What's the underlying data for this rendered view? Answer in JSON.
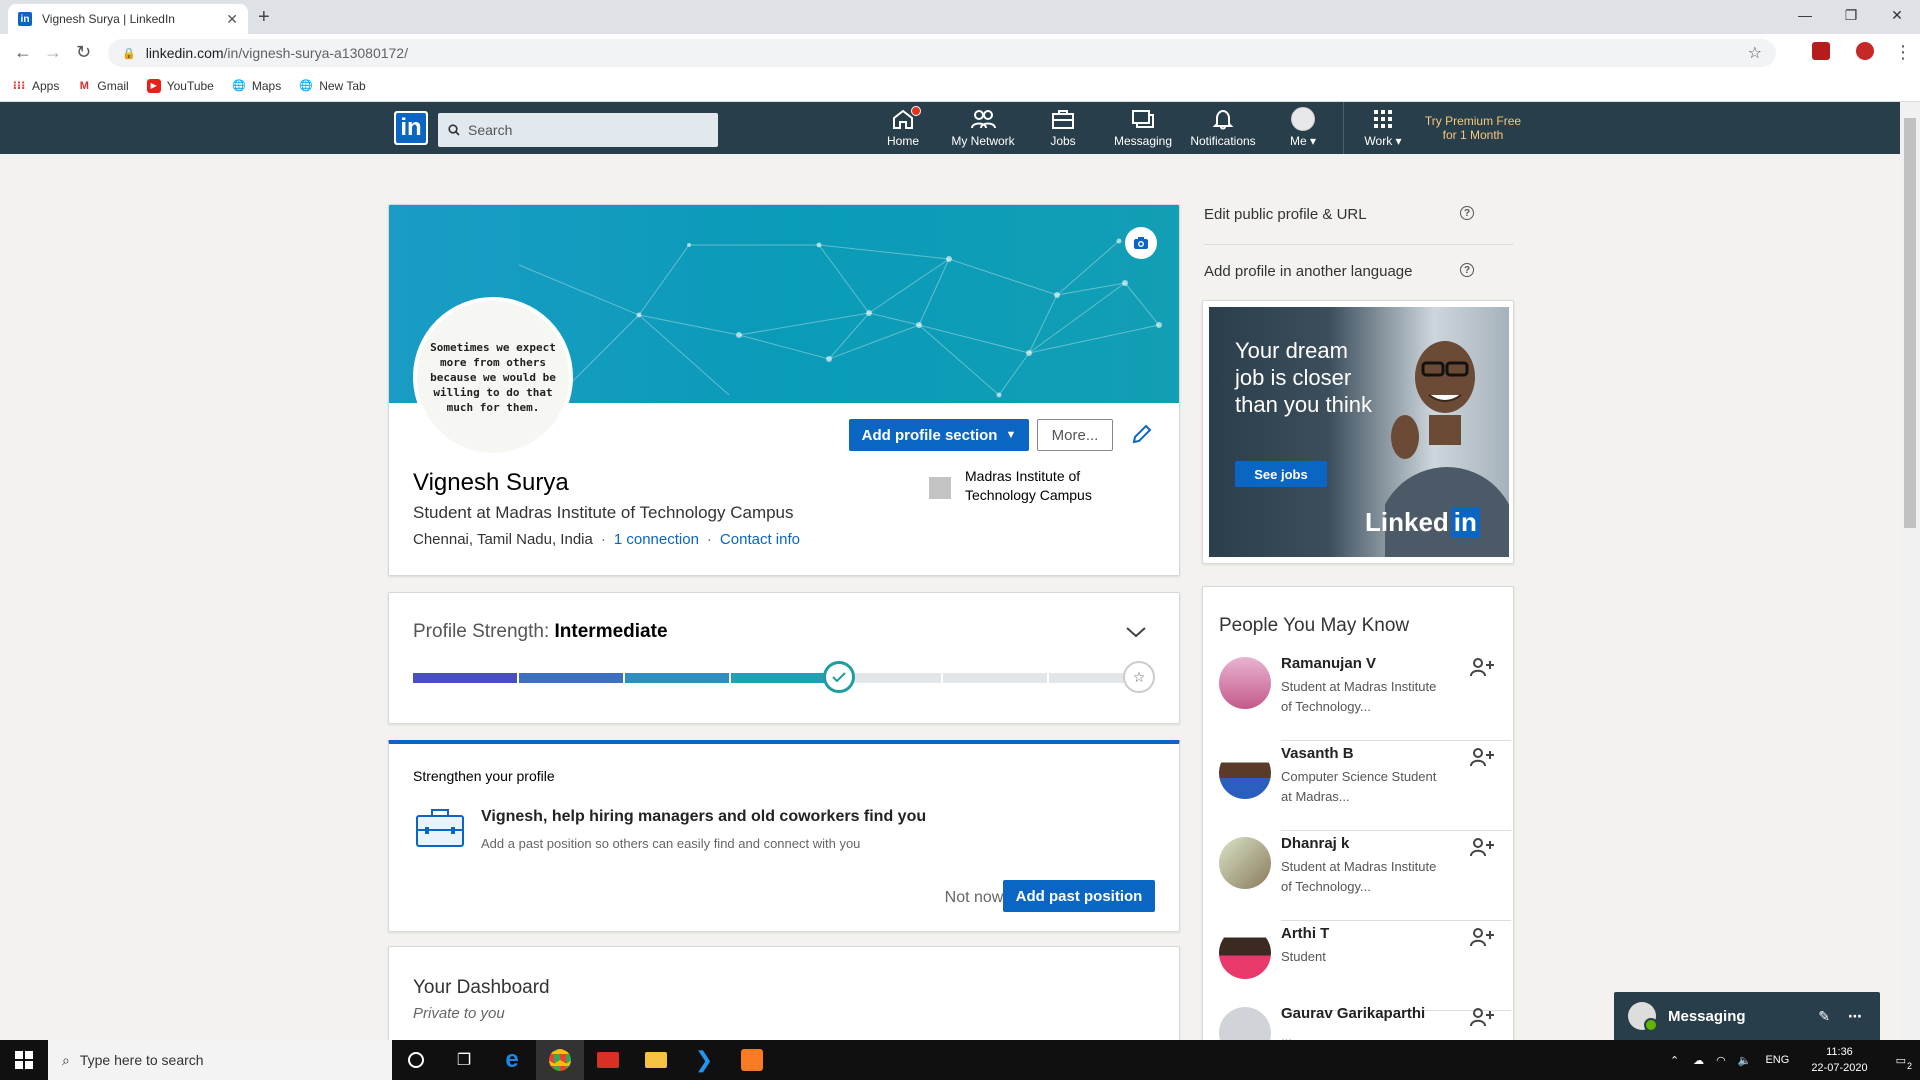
{
  "browser": {
    "tab_title": "Vignesh Surya | LinkedIn",
    "favicon": "in",
    "new_tab": "+",
    "url_host": "linkedin.com",
    "url_path": "/in/vignesh-surya-a13080172/",
    "bookmarks": [
      "Apps",
      "Gmail",
      "YouTube",
      "Maps",
      "New Tab"
    ]
  },
  "nav": {
    "logo": "in",
    "search_placeholder": "Search",
    "items": [
      {
        "label": "Home",
        "icon": "home-icon"
      },
      {
        "label": "My Network",
        "icon": "network-icon"
      },
      {
        "label": "Jobs",
        "icon": "briefcase-icon"
      },
      {
        "label": "Messaging",
        "icon": "messaging-icon"
      },
      {
        "label": "Notifications",
        "icon": "bell-icon"
      },
      {
        "label": "Me",
        "icon": "avatar-icon"
      },
      {
        "label": "Work",
        "icon": "grid-icon"
      }
    ],
    "premium": "Try Premium Free for 1 Month"
  },
  "profile": {
    "avatar_quote": "Sometimes we expect more from others because we would be willing to do that much for them.",
    "add_section": "Add profile section",
    "more": "More...",
    "name": "Vignesh Surya",
    "headline": "Student at Madras Institute of Technology Campus",
    "location": "Chennai, Tamil Nadu, India",
    "connections": "1 connection",
    "contact": "Contact info",
    "school": "Madras Institute of Technology Campus"
  },
  "strength": {
    "label": "Profile Strength:",
    "level": "Intermediate",
    "progress_fraction": 0.5
  },
  "strengthen": {
    "title": "Strengthen your profile",
    "headline": "Vignesh, help hiring managers and old coworkers find you",
    "subtext": "Add a past position so others can easily find and connect with you",
    "not_now": "Not now",
    "add_past": "Add past position"
  },
  "dashboard": {
    "title": "Your Dashboard",
    "subtitle": "Private to you"
  },
  "right_rail": {
    "edit_public": "Edit public profile & URL",
    "add_language": "Add profile in another language",
    "ad_text": "Your dream job is closer than you think",
    "ad_button": "See jobs",
    "ad_logo_text": "Linked",
    "ad_logo_in": "in"
  },
  "pymk": {
    "title": "People You May Know",
    "people": [
      {
        "name": "Ramanujan V",
        "desc": "Student at Madras Institute of Technology..."
      },
      {
        "name": "Vasanth B",
        "desc": "Computer Science Student at Madras..."
      },
      {
        "name": "Dhanraj k",
        "desc": "Student at Madras Institute of Technology..."
      },
      {
        "name": "Arthi T",
        "desc": "Student"
      },
      {
        "name": "Gaurav Garikaparthi",
        "desc": "..."
      }
    ]
  },
  "messaging": {
    "label": "Messaging"
  },
  "taskbar": {
    "search": "Type here to search",
    "lang": "ENG",
    "time": "11:36",
    "date": "22-07-2020",
    "notif_count": "2"
  },
  "colors": {
    "linkedin_blue": "#0a66c2",
    "nav_bg": "#283e4a",
    "banner": "#0a9bb8"
  }
}
